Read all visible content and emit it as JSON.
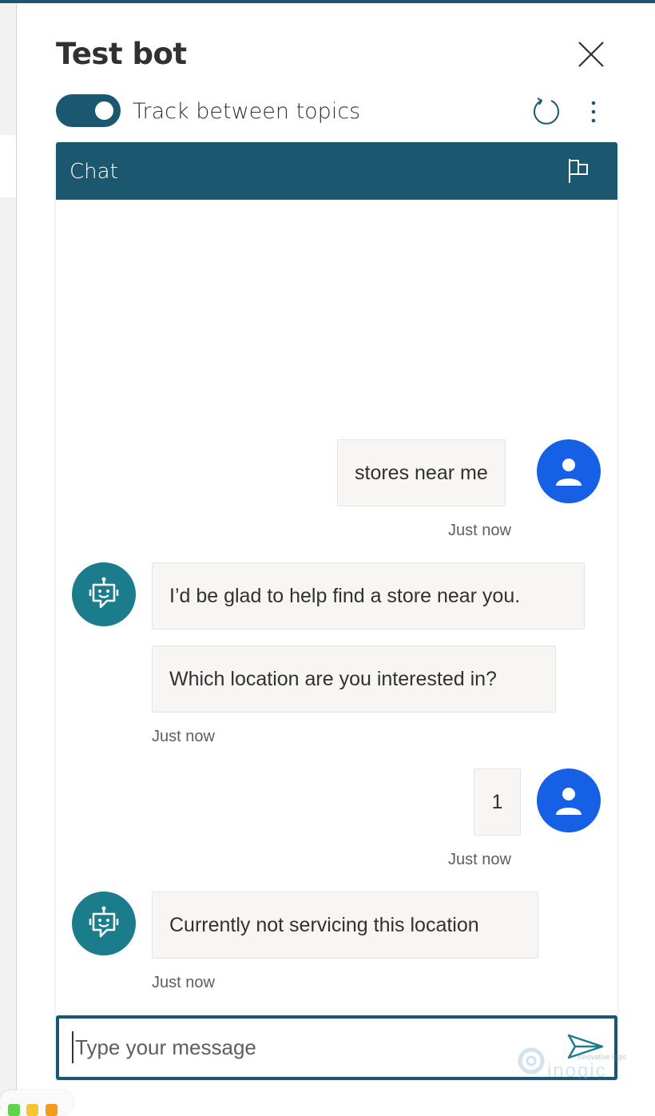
{
  "header": {
    "title": "Test bot",
    "toggle_label": "Track between topics",
    "toggle_on": true
  },
  "chat": {
    "title": "Chat",
    "messages": [
      {
        "from": "user",
        "text": "stores near me",
        "time": "Just now"
      },
      {
        "from": "bot",
        "text": "I’d be glad to help find a store near you."
      },
      {
        "from": "bot",
        "text": "Which location are you interested in?",
        "time": "Just now"
      },
      {
        "from": "user",
        "text": "1",
        "time": "Just now"
      },
      {
        "from": "bot",
        "text": "Currently not servicing this location",
        "time": "Just now"
      }
    ]
  },
  "input": {
    "placeholder": "Type your message"
  },
  "watermark": {
    "brand": "inogic",
    "tagline": "innovative logic"
  },
  "colors": {
    "accent": "#1c5770",
    "user_avatar": "#1660e5",
    "bot_avatar": "#1b7d8c"
  }
}
